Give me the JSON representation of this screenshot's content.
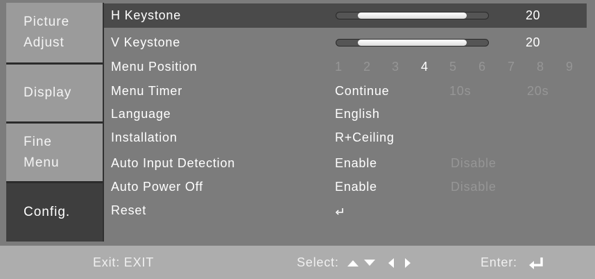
{
  "tabs": [
    {
      "line1": "Picture",
      "line2": "Adjust",
      "active": false
    },
    {
      "line1": "Display",
      "line2": "",
      "active": false
    },
    {
      "line1": "Fine",
      "line2": "Menu",
      "active": false
    },
    {
      "line1": "Config.",
      "line2": "",
      "active": true
    }
  ],
  "rows": {
    "h_keystone": {
      "label": "H Keystone",
      "value": "20",
      "level_fraction": 0.86
    },
    "v_keystone": {
      "label": "V Keystone",
      "value": "20",
      "level_fraction": 0.86
    },
    "menu_position": {
      "label": "Menu Position",
      "options": [
        "1",
        "2",
        "3",
        "4",
        "5",
        "6",
        "7",
        "8",
        "9"
      ],
      "selected": "4"
    },
    "menu_timer": {
      "label": "Menu Timer",
      "options": [
        "Continue",
        "10s",
        "20s"
      ],
      "selected": "Continue"
    },
    "language": {
      "label": "Language",
      "value": "English"
    },
    "installation": {
      "label": "Installation",
      "value": "R+Ceiling"
    },
    "auto_input_detection": {
      "label": "Auto Input Detection",
      "options": [
        "Enable",
        "Disable"
      ],
      "selected": "Enable"
    },
    "auto_power_off": {
      "label": "Auto Power Off",
      "options": [
        "Enable",
        "Disable"
      ],
      "selected": "Enable"
    },
    "reset": {
      "label": "Reset",
      "icon": "enter-icon"
    }
  },
  "footer": {
    "exit": "Exit: EXIT",
    "select": "Select:",
    "enter": "Enter:"
  },
  "colors": {
    "background": "#7c7c7c",
    "selected_row": "#4a4a4a",
    "active_tab": "#3e3e3e",
    "inactive_tab": "#9b9b9b",
    "footer": "#adadad",
    "dim_text": "#969696"
  }
}
